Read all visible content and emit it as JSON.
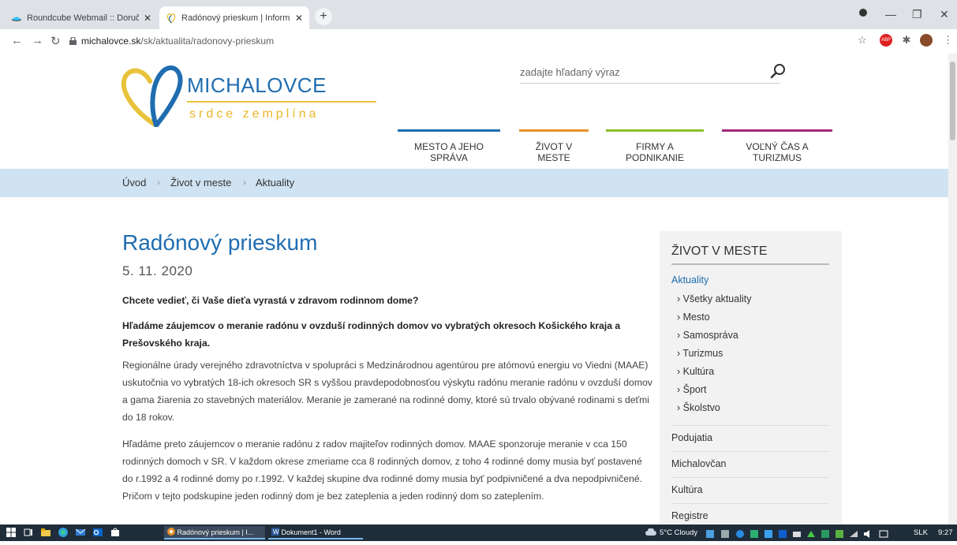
{
  "browser": {
    "tabs": [
      {
        "title": "Roundcube Webmail :: Doručená",
        "close": "✕"
      },
      {
        "title": "Radónový prieskum | Informačný",
        "close": "✕"
      }
    ],
    "new_tab": "+",
    "url_host": "michalovce.sk",
    "url_path": "/sk/aktualita/radonovy-prieskum"
  },
  "site": {
    "logo_title": "MICHALOVCE",
    "logo_subtitle": "srdce zemplína",
    "search_placeholder": "zadajte hľadaný výraz",
    "nav": [
      {
        "label": "MESTO A JEHO SPRÁVA",
        "color": "#1f6db0"
      },
      {
        "label": "ŽIVOT V MESTE",
        "color": "#e8912a"
      },
      {
        "label": "FIRMY A PODNIKANIE",
        "color": "#8dbd2a"
      },
      {
        "label": "VOĽNÝ ČAS A TURIZMUS",
        "color": "#a0287a"
      }
    ],
    "breadcrumb": [
      "Úvod",
      "Život v meste",
      "Aktuality"
    ],
    "breadcrumb_sep": "›"
  },
  "article": {
    "title": "Radónový prieskum",
    "date": "5. 11. 2020",
    "lead1": "Chcete vedieť, či Vaše dieťa vyrastá v zdravom rodinnom dome?",
    "lead2": "Hľadáme záujemcov o meranie radónu v ovzduší  rodinných domov vo vybratých okresoch Košického kraja a Prešovského kraja.",
    "para1": "Regionálne úrady verejného zdravotníctva v spolupráci s Medzinárodnou agentúrou pre atómovú energiu vo Viedni (MAAE) uskutočnia vo vybratých 18-ich okresoch SR s vyššou pravdepodobnosťou výskytu radónu meranie radónu v ovzduší domov a gama žiarenia zo stavebných materiálov. Meranie je zamerané na rodinné domy, ktoré sú trvalo obývané rodinami s deťmi do 18 rokov.",
    "para2": "Hľadáme preto záujemcov o meranie radónu z radov majiteľov rodinných domov. MAAE sponzoruje meranie v cca 150 rodinných domoch v SR. V každom okrese zmeriame cca 8 rodinných domov, z toho 4 rodinné domy musia byť postavené do r.1992 a 4 rodinné domy po r.1992. V každej skupine dva rodinné domy musia byť podpivničené a dva nepodpivničené. Pričom v tejto podskupine jeden rodinný dom je bez zateplenia a jeden rodinný dom so zateplením."
  },
  "sidebar": {
    "title": "ŽIVOT V MESTE",
    "active": "Aktuality",
    "subitems": [
      "Všetky aktuality",
      "Mesto",
      "Samospráva",
      "Turizmus",
      "Kultúra",
      "Šport",
      "Školstvo"
    ],
    "items": [
      "Podujatia",
      "Michalovčan",
      "Kultúra",
      "Registre"
    ]
  },
  "taskbar": {
    "apps": [
      "Radónový prieskum | I...",
      "Dokument1 - Word"
    ],
    "weather": "5°C  Cloudy",
    "lang": "SLK",
    "time": "9:27"
  }
}
